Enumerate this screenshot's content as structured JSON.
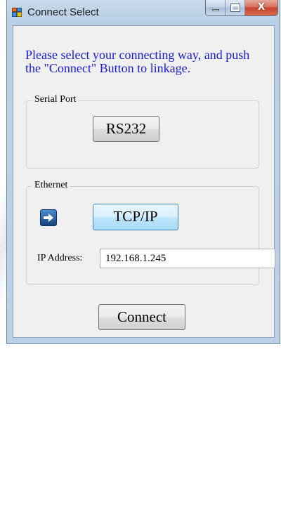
{
  "window": {
    "title": "Connect Select",
    "controls": {
      "close_label": "X"
    }
  },
  "prompt": "Please select your connecting way, and push the \"Connect\" Button to linkage.",
  "serial_group": {
    "label": "Serial Port",
    "rs232_button": "RS232"
  },
  "ethernet_group": {
    "label": "Ethernet",
    "tcp_button": "TCP/IP",
    "ip_label": "IP Address:",
    "ip_value": "192.168.1.245"
  },
  "connect_button": "Connect",
  "colors": {
    "prompt_text": "#1a1ad8",
    "arrow_icon_bg": "#1f5fa8"
  },
  "icons": {
    "app": "app-window-icon",
    "arrow": "right-arrow-icon"
  }
}
